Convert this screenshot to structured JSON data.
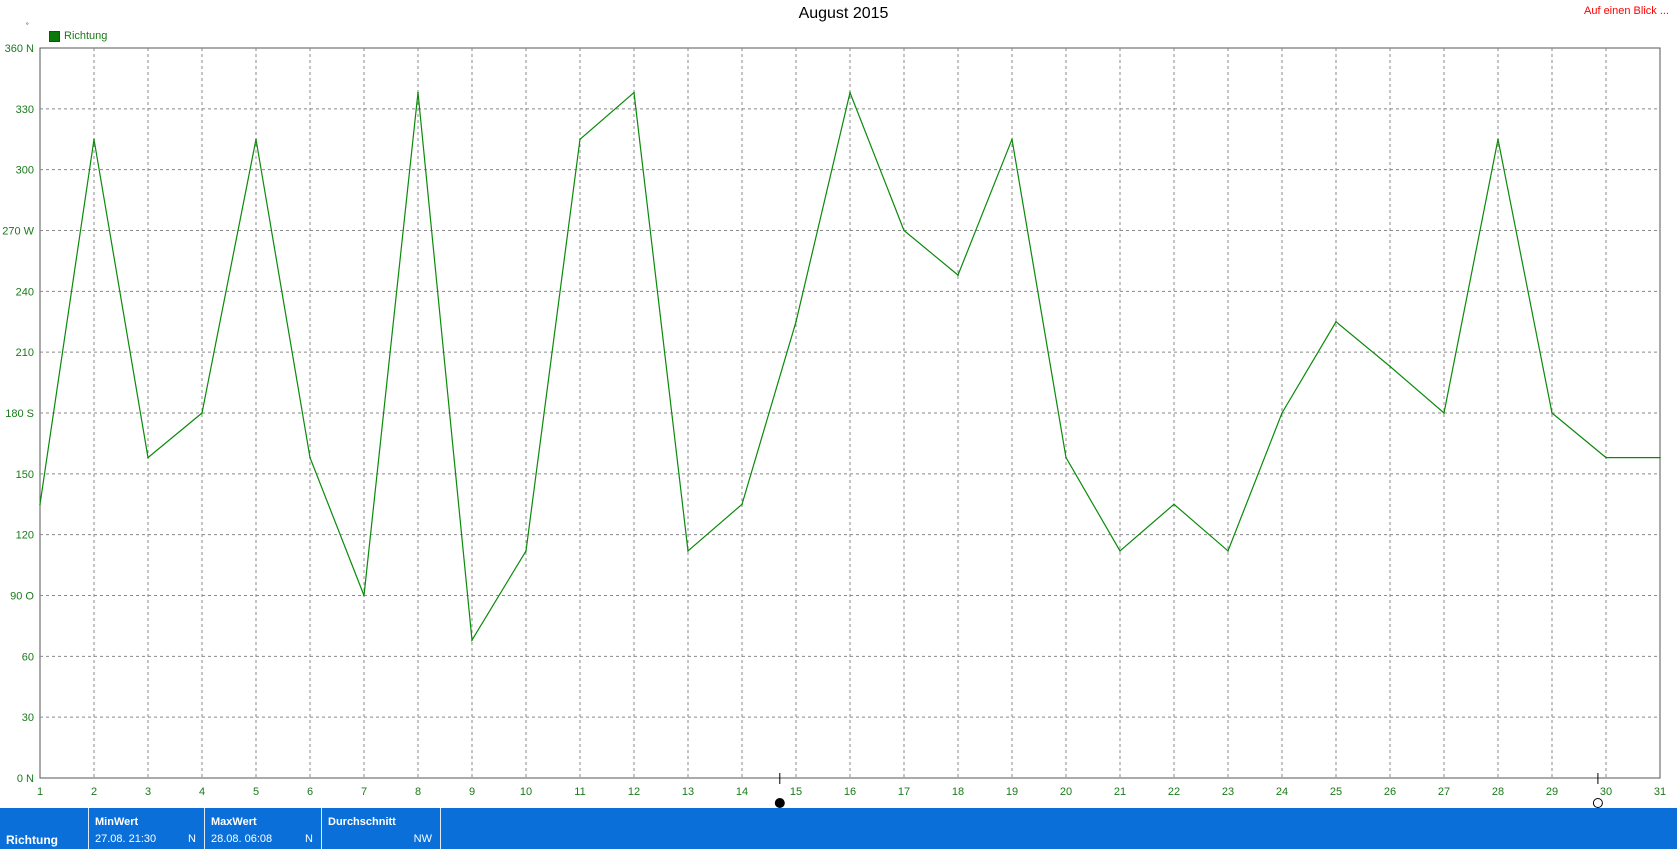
{
  "title": "August 2015",
  "overview_link": "Auf einen Blick ...",
  "corner_mark": "˚",
  "legend": {
    "label": "Richtung",
    "color": "#0a7a0a"
  },
  "chart_data": {
    "type": "line",
    "title": "August 2015",
    "xlabel": "",
    "ylabel": "",
    "grid": true,
    "legend_position": "top-left",
    "xlim": [
      1,
      31
    ],
    "ylim": [
      0,
      360
    ],
    "x_ticks": [
      "1",
      "2",
      "3",
      "4",
      "5",
      "6",
      "7",
      "8",
      "9",
      "10",
      "11",
      "12",
      "13",
      "14",
      "15",
      "16",
      "17",
      "18",
      "19",
      "20",
      "21",
      "22",
      "23",
      "24",
      "25",
      "26",
      "27",
      "28",
      "29",
      "30",
      "31"
    ],
    "y_ticks": [
      "0  N",
      "30",
      "60",
      "90  O",
      "120",
      "150",
      "180 S",
      "210",
      "240",
      "270 W",
      "300",
      "330",
      "360 N"
    ],
    "moon_phase_markers": [
      {
        "day": 14.7,
        "phase": "new-moon"
      },
      {
        "day": 29.85,
        "phase": "full-moon"
      }
    ],
    "series": [
      {
        "name": "Richtung",
        "color": "#0a8a0a",
        "x": [
          1,
          2,
          3,
          4,
          5,
          6,
          7,
          8,
          9,
          10,
          11,
          12,
          13,
          14,
          15,
          16,
          17,
          18,
          19,
          20,
          21,
          22,
          23,
          24,
          25,
          26,
          27,
          28,
          29,
          30,
          31
        ],
        "values": [
          135,
          315,
          158,
          180,
          315,
          158,
          90,
          338,
          68,
          112,
          315,
          338,
          112,
          135,
          225,
          338,
          270,
          248,
          315,
          158,
          112,
          135,
          112,
          180,
          225,
          203,
          180,
          315,
          180,
          158,
          158
        ]
      }
    ]
  },
  "footer": {
    "series_label": "Richtung",
    "min": {
      "heading": "MinWert",
      "datetime": "27.08.  21:30",
      "unit": "N"
    },
    "max": {
      "heading": "MaxWert",
      "datetime": "28.08.  06:08",
      "unit": "N"
    },
    "avg": {
      "heading": "Durchschnitt",
      "unit": "NW"
    }
  }
}
